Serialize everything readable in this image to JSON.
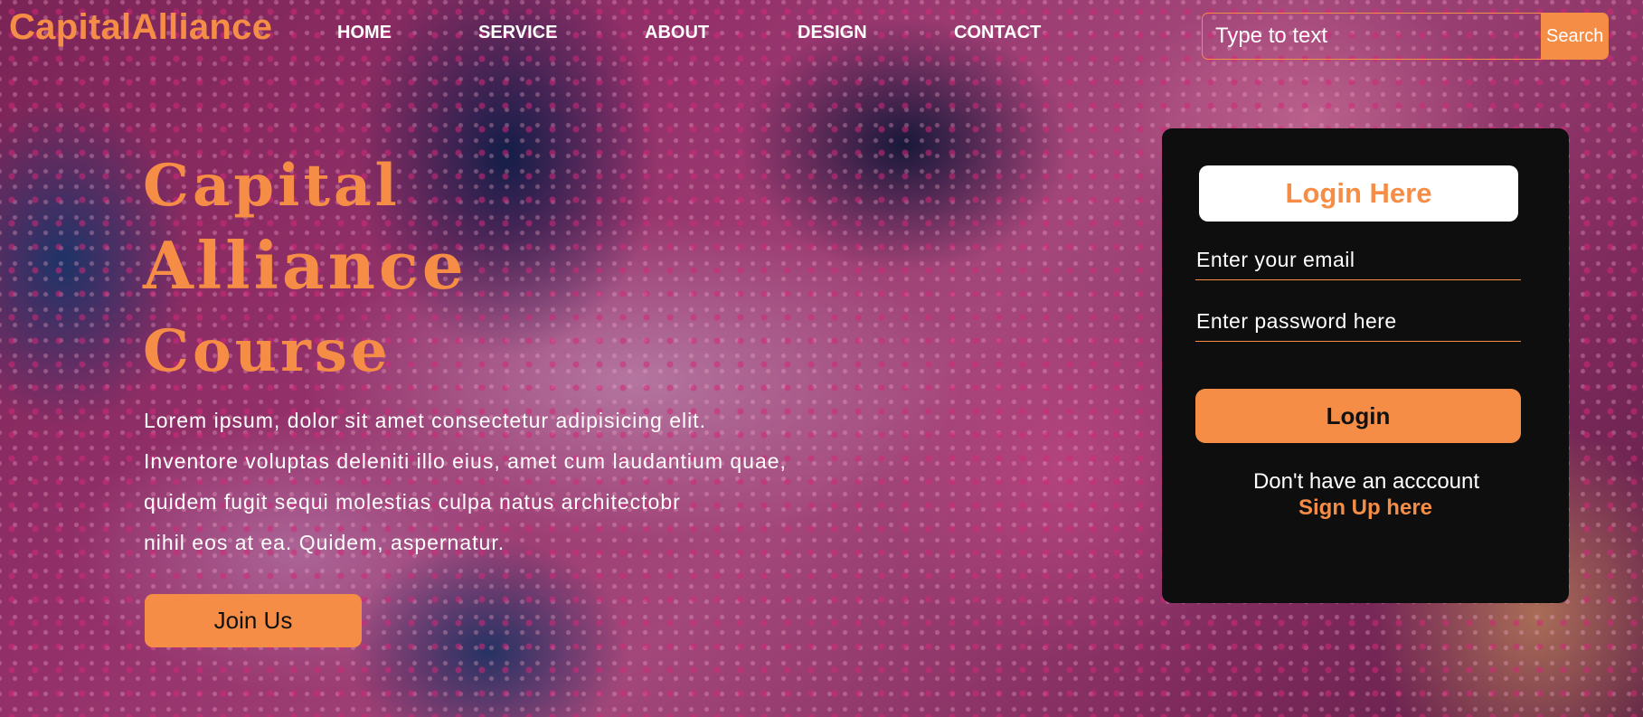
{
  "header": {
    "brand": "CapitalAlliance",
    "nav": [
      "HOME",
      "SERVICE",
      "ABOUT",
      "DESIGN",
      "CONTACT"
    ],
    "search": {
      "placeholder": "Type to text",
      "button_label": "Search"
    }
  },
  "hero": {
    "title_lines": [
      "Capital",
      "Alliance",
      "Course"
    ],
    "paragraph_lines": [
      "Lorem ipsum, dolor sit amet consectetur adipisicing elit.",
      "Inventore voluptas deleniti illo eius, amet cum laudantium quae,",
      "quidem fugit sequi molestias culpa natus architectobr",
      "nihil eos at ea. Quidem, aspernatur."
    ],
    "join_button_label": "Join Us"
  },
  "login": {
    "heading": "Login Here",
    "email_placeholder": "Enter your email",
    "password_placeholder": "Enter password here",
    "button_label": "Login",
    "no_account_text": "Don't have an acccount",
    "signup_link_label": "Sign Up here"
  },
  "colors": {
    "accent": "#f58d46",
    "card_background": "#0f0e0f",
    "text_light": "#ffffff"
  }
}
